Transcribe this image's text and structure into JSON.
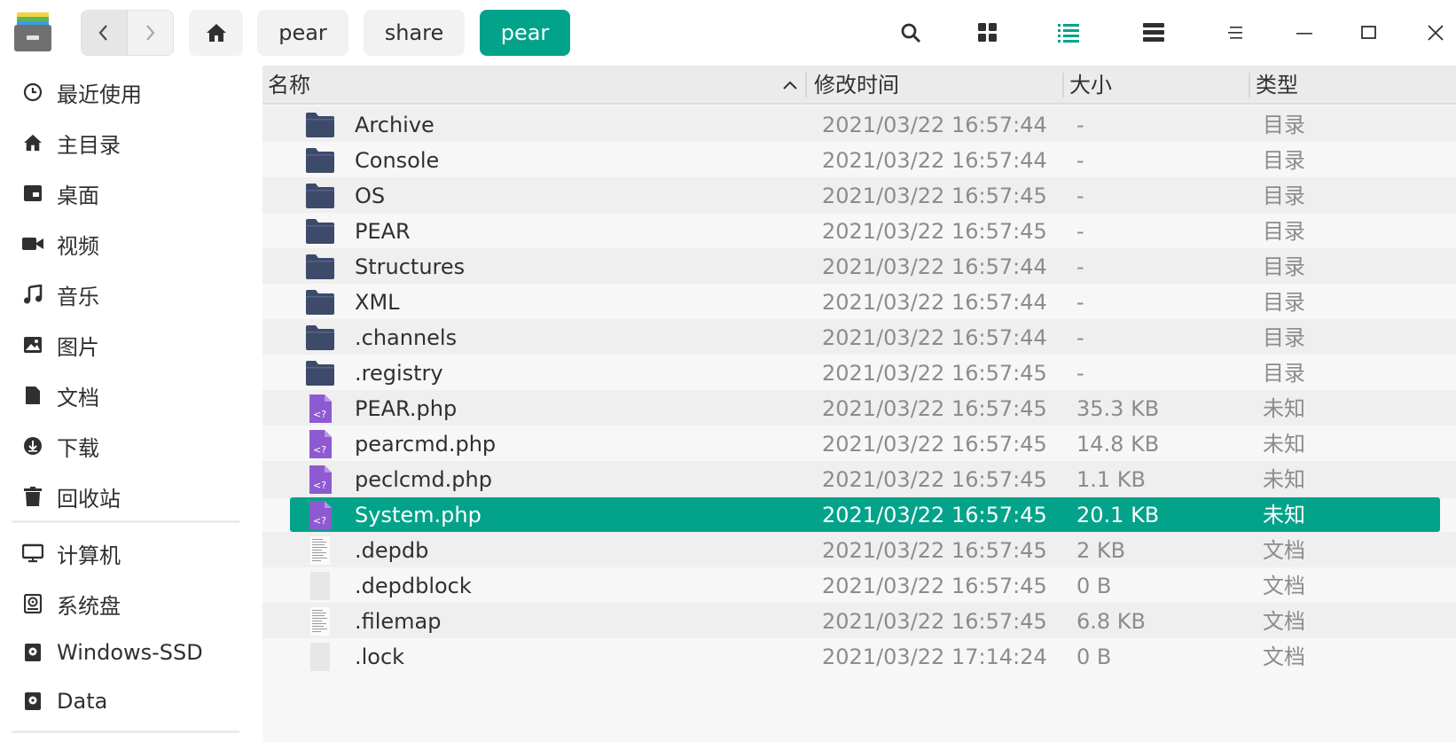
{
  "breadcrumbs": [
    "pear",
    "share",
    "pear"
  ],
  "columns": {
    "name": "名称",
    "modified": "修改时间",
    "size": "大小",
    "type": "类型"
  },
  "sidebar": {
    "places": [
      {
        "label": "最近使用",
        "icon": "clock-icon"
      },
      {
        "label": "主目录",
        "icon": "home-icon"
      },
      {
        "label": "桌面",
        "icon": "desktop-icon"
      },
      {
        "label": "视频",
        "icon": "video-icon"
      },
      {
        "label": "音乐",
        "icon": "music-icon"
      },
      {
        "label": "图片",
        "icon": "image-icon"
      },
      {
        "label": "文档",
        "icon": "document-icon"
      },
      {
        "label": "下载",
        "icon": "download-icon"
      },
      {
        "label": "回收站",
        "icon": "trash-icon"
      }
    ],
    "devices": [
      {
        "label": "计算机",
        "icon": "computer-icon"
      },
      {
        "label": "系统盘",
        "icon": "system-disk-icon"
      },
      {
        "label": "Windows-SSD",
        "icon": "disk-icon"
      },
      {
        "label": "Data",
        "icon": "disk-icon"
      }
    ]
  },
  "files": [
    {
      "name": "Archive",
      "modified": "2021/03/22 16:57:44",
      "size": "-",
      "type": "目录",
      "kind": "folder"
    },
    {
      "name": "Console",
      "modified": "2021/03/22 16:57:44",
      "size": "-",
      "type": "目录",
      "kind": "folder"
    },
    {
      "name": "OS",
      "modified": "2021/03/22 16:57:45",
      "size": "-",
      "type": "目录",
      "kind": "folder"
    },
    {
      "name": "PEAR",
      "modified": "2021/03/22 16:57:45",
      "size": "-",
      "type": "目录",
      "kind": "folder"
    },
    {
      "name": "Structures",
      "modified": "2021/03/22 16:57:44",
      "size": "-",
      "type": "目录",
      "kind": "folder"
    },
    {
      "name": "XML",
      "modified": "2021/03/22 16:57:44",
      "size": "-",
      "type": "目录",
      "kind": "folder"
    },
    {
      "name": ".channels",
      "modified": "2021/03/22 16:57:44",
      "size": "-",
      "type": "目录",
      "kind": "folder"
    },
    {
      "name": ".registry",
      "modified": "2021/03/22 16:57:45",
      "size": "-",
      "type": "目录",
      "kind": "folder"
    },
    {
      "name": "PEAR.php",
      "modified": "2021/03/22 16:57:45",
      "size": "35.3 KB",
      "type": "未知",
      "kind": "php"
    },
    {
      "name": "pearcmd.php",
      "modified": "2021/03/22 16:57:45",
      "size": "14.8 KB",
      "type": "未知",
      "kind": "php"
    },
    {
      "name": "peclcmd.php",
      "modified": "2021/03/22 16:57:45",
      "size": "1.1 KB",
      "type": "未知",
      "kind": "php"
    },
    {
      "name": "System.php",
      "modified": "2021/03/22 16:57:45",
      "size": "20.1 KB",
      "type": "未知",
      "kind": "php",
      "selected": true
    },
    {
      "name": ".depdb",
      "modified": "2021/03/22 16:57:45",
      "size": "2 KB",
      "type": "文档",
      "kind": "text"
    },
    {
      "name": ".depdblock",
      "modified": "2021/03/22 16:57:45",
      "size": "0 B",
      "type": "文档",
      "kind": "blank"
    },
    {
      "name": ".filemap",
      "modified": "2021/03/22 16:57:45",
      "size": "6.8 KB",
      "type": "文档",
      "kind": "text"
    },
    {
      "name": ".lock",
      "modified": "2021/03/22 17:14:24",
      "size": "0 B",
      "type": "文档",
      "kind": "blank"
    }
  ],
  "colors": {
    "accent": "#02a38a",
    "folder": "#3d4a69",
    "php": "#8e5ad1"
  }
}
